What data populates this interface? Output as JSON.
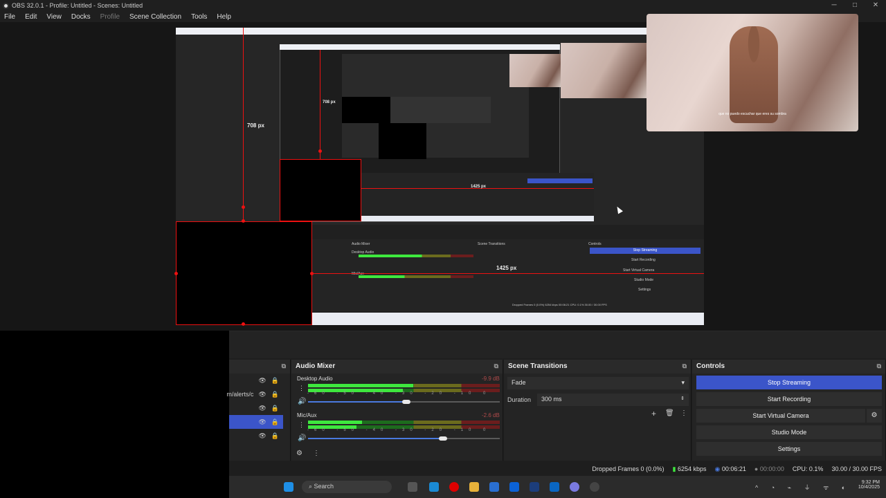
{
  "window": {
    "title": "OBS 32.0.1 - Profile: Untitled - Scenes: Untitled",
    "buttons": [
      "─",
      "□",
      "✕"
    ]
  },
  "menu": [
    "File",
    "Edit",
    "View",
    "Docks",
    "Profile",
    "Scene Collection",
    "Tools",
    "Help"
  ],
  "preview": {
    "height_label": "708 px",
    "inner_height_label": "708 px",
    "width_label": "1425 px",
    "inner_width_label": "1425 px",
    "webcam_caption": "que no puedo escuchar que eres su sombra",
    "nested_controls": [
      "Stop Streaming",
      "Start Recording",
      "Start Virtual Camera",
      "Studio Mode",
      "Settings"
    ],
    "nested_mixer": [
      "Desktop Audio",
      "Mic/Aux"
    ],
    "nested_status": "Dropped Frames 0 (0.0%)   6254 kbps   00:06:21   CPU: 0.1%   30.00 / 30.00 FPS"
  },
  "scenes_dock": {
    "visible_source_text": "m/alerts/c"
  },
  "audio_mixer": {
    "title": "Audio Mixer",
    "channels": [
      {
        "name": "Desktop Audio",
        "db": "-9.9 dB",
        "level": 0.55,
        "volume": 0.64
      },
      {
        "name": "Mic/Aux",
        "db": "-2.6 dB",
        "level": 0.28,
        "volume": 0.88
      }
    ],
    "scale": [
      "-60",
      "-55",
      "-50",
      "-45",
      "-40",
      "-35",
      "-30",
      "-25",
      "-20",
      "-15",
      "-10",
      "-5",
      "0"
    ]
  },
  "scene_transitions": {
    "title": "Scene Transitions",
    "transition": "Fade",
    "duration_label": "Duration",
    "duration_value": "300 ms"
  },
  "controls": {
    "title": "Controls",
    "buttons": [
      "Stop Streaming",
      "Start Recording",
      "Start Virtual Camera",
      "Studio Mode",
      "Settings"
    ]
  },
  "status": {
    "dropped": "Dropped Frames 0 (0.0%)",
    "bitrate": "6254 kbps",
    "stream_time": "00:06:21",
    "rec_time": "00:00:00",
    "cpu": "CPU: 0.1%",
    "fps": "30.00 / 30.00 FPS"
  },
  "taskbar": {
    "search_placeholder": "Search",
    "time": "9:32 PM",
    "date": "10/4/2025"
  },
  "colors": {
    "accent": "#3b55c9",
    "selection_red": "#e11111"
  }
}
